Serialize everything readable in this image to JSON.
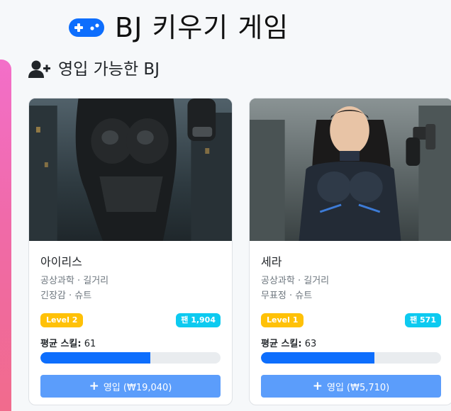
{
  "header": {
    "title": "BJ 키우기 게임",
    "icon": "gamepad-icon",
    "icon_color": "#0d6efd"
  },
  "section": {
    "title": "영입 가능한 BJ",
    "icon": "user-plus-icon"
  },
  "cards": [
    {
      "name": "아이리스",
      "tags_line1": "공상과학 · 길거리",
      "tags_line2": "긴장감 · 슈트",
      "level": "Level 2",
      "fans": "팬 1,904",
      "skill_label": "평균 스킬:",
      "skill_value": "61",
      "skill_percent": 61,
      "hire_label": "영입 (₩19,040)"
    },
    {
      "name": "세라",
      "tags_line1": "공상과학 · 길거리",
      "tags_line2": "무표정 · 슈트",
      "level": "Level 1",
      "fans": "팬 571",
      "skill_label": "평균 스킬:",
      "skill_value": "63",
      "skill_percent": 63,
      "hire_label": "영입 (₩5,710)"
    }
  ],
  "colors": {
    "level_badge": "#ffc107",
    "fan_badge": "#0dcaf0",
    "progress": "#0d6efd",
    "button": "#5b9dfb",
    "side_tab": "#f06aa8"
  }
}
